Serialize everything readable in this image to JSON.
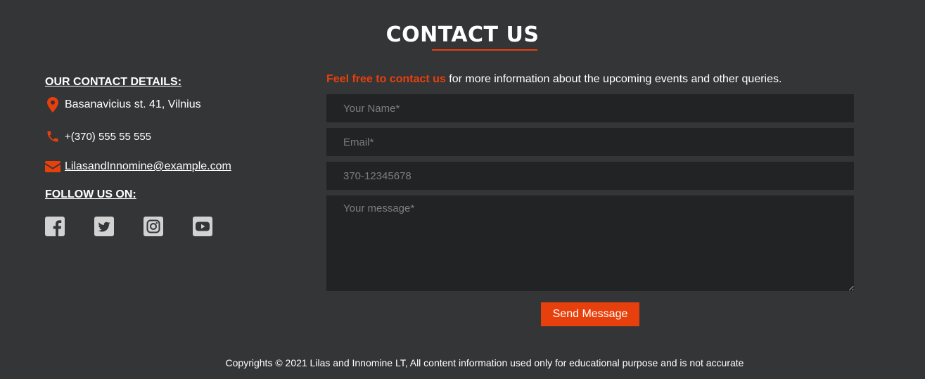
{
  "page": {
    "title": "CONTACT US"
  },
  "colors": {
    "background": "#343537",
    "accent": "#e8400c",
    "field_background": "#222325",
    "text": "#ffffff",
    "placeholder": "#7c7d80"
  },
  "contact_details": {
    "heading": "OUR CONTACT DETAILS:",
    "address": {
      "icon": "map-marker-icon",
      "text": "Basanavicius st. 41, Vilnius"
    },
    "phone": {
      "icon": "phone-icon",
      "text": "+(370) 555 55 555"
    },
    "email": {
      "icon": "envelope-icon",
      "text": "LilasandInnomine@example.com"
    }
  },
  "follow": {
    "heading": "FOLLOW US ON:",
    "networks": [
      {
        "icon": "facebook-icon"
      },
      {
        "icon": "twitter-icon"
      },
      {
        "icon": "instagram-icon"
      },
      {
        "icon": "youtube-icon"
      }
    ]
  },
  "form": {
    "intro_accent": "Feel free to contact us",
    "intro_rest": " for more information about the upcoming events and other queries.",
    "name_placeholder": "Your Name*",
    "email_placeholder": "Email*",
    "phone_placeholder": "370-12345678",
    "message_placeholder": "Your message*",
    "name_value": "",
    "email_value": "",
    "phone_value": "",
    "message_value": "",
    "send_label": "Send Message"
  },
  "footer": {
    "copyright": "Copyrights © 2021 Lilas and Innomine LT, All content information used only for educational purpose and is not accurate"
  }
}
